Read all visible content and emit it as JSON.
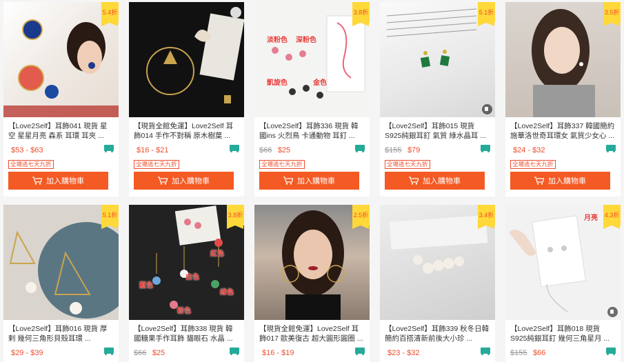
{
  "products": [
    {
      "name": "【Love2Self】耳飾041 現貨 星空 星星月亮 森系 耳環 耳夾 ...",
      "old_price": "",
      "price": "$53 - $63",
      "discount": "5.4折",
      "guarantee": "全場逃七天九折",
      "button": "加入購物車",
      "has_video": false,
      "labels": []
    },
    {
      "name": "【現貨全館免運】Love2Self 耳飾014 手作不對稱 原木樹葉 ...",
      "old_price": "",
      "price": "$16 - $21",
      "discount": "",
      "guarantee": "全場逃七天九折",
      "button": "加入購物車",
      "has_video": false,
      "labels": []
    },
    {
      "name": "【Love2Self】耳飾336 現貨 韓國ins 火烈鳥 卡通動物 耳釘 ...",
      "old_price": "$66",
      "price": "$25",
      "discount": "3.8折",
      "guarantee": "全場逃七天九折",
      "button": "加入購物車",
      "has_video": false,
      "labels": [
        "淡粉色",
        "深粉色",
        "凱旋色",
        "金色"
      ]
    },
    {
      "name": "【Love2Self】耳飾015 現貨 S925純銀耳釘 氣質 綠水晶耳 ...",
      "old_price": "$155",
      "price": "$79",
      "discount": "5.1折",
      "guarantee": "全場逃七天九折",
      "button": "加入購物車",
      "has_video": true,
      "labels": []
    },
    {
      "name": "【Love2Self】耳飾337 韓國簡約施華洛世奇耳環女 氣質少女心 ...",
      "old_price": "",
      "price": "$24 - $32",
      "discount": "3.5折",
      "guarantee": "全場逃七天九折",
      "button": "加入購物車",
      "has_video": false,
      "labels": []
    },
    {
      "name": "【Love2Self】耳飾016 現貨 厚剌 幾何三角形貝殼耳環 ...",
      "old_price": "",
      "price": "$29 - $39",
      "discount": "5.1折",
      "guarantee": "",
      "button": "",
      "has_video": false,
      "labels": []
    },
    {
      "name": "【Love2Self】耳飾338 現貨 韓國糖果手作耳飾 貓眼石 水晶 ...",
      "old_price": "$66",
      "price": "$25",
      "discount": "3.8折",
      "guarantee": "",
      "button": "",
      "has_video": false,
      "labels": [
        "紅色",
        "白色",
        "藍色",
        "綠色",
        "粉色"
      ]
    },
    {
      "name": "【現貨全館免運】Love2Self 耳飾017 歐美復古 超大圓形圓圈 ...",
      "old_price": "",
      "price": "$16 - $19",
      "discount": "2.5折",
      "guarantee": "",
      "button": "",
      "has_video": false,
      "labels": []
    },
    {
      "name": "【Love2Self】耳飾339 秋冬日韓簡約百搭清新前後大小珍 ...",
      "old_price": "",
      "price": "$23 - $32",
      "discount": "3.4折",
      "guarantee": "",
      "button": "",
      "has_video": false,
      "labels": []
    },
    {
      "name": "【Love2Self】耳飾018 現貨 S925純銀耳釘 幾何三角星月 ...",
      "old_price": "$155",
      "price": "$66",
      "discount": "4.3折",
      "guarantee": "",
      "button": "",
      "has_video": true,
      "labels": [
        "月亮"
      ]
    }
  ],
  "colors": {
    "accent": "#ee4d2d",
    "button": "#f45a24",
    "badge": "#ffd839",
    "free_shipping": "#26aa99"
  }
}
